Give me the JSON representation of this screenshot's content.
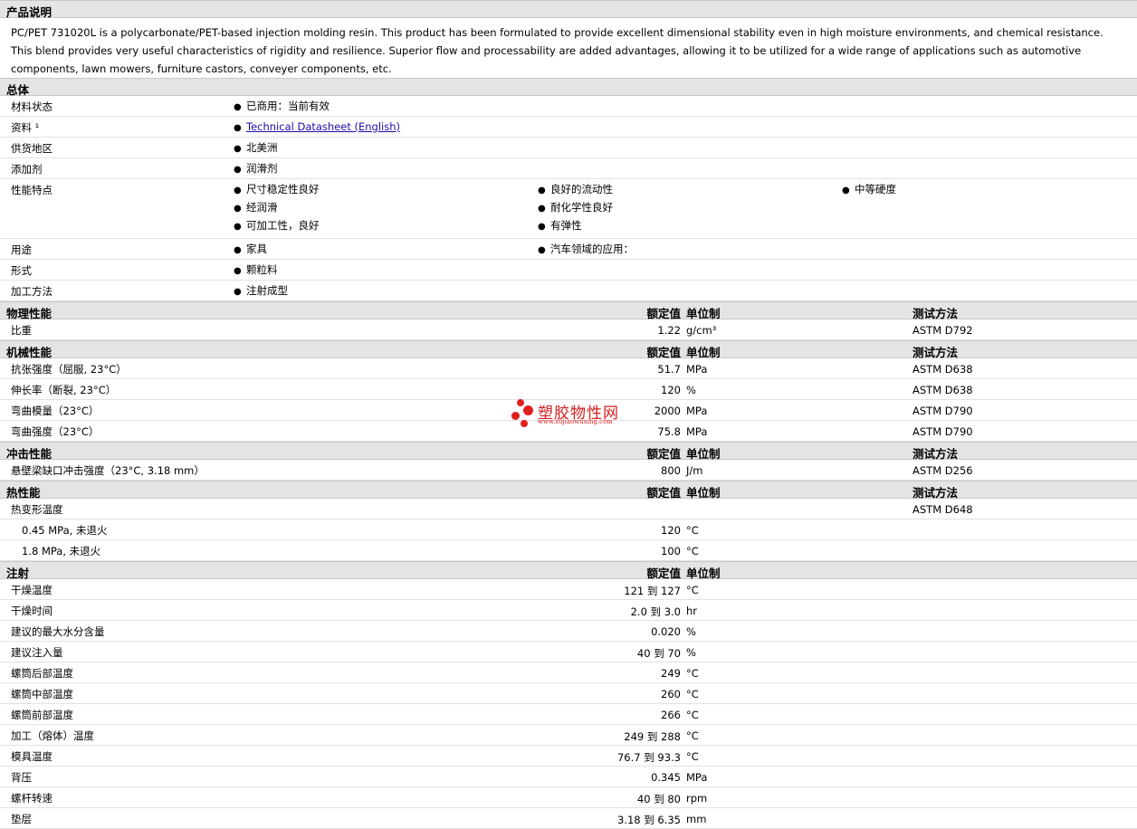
{
  "description": {
    "header": "产品说明",
    "text": "PC/PET 731020L is a polycarbonate/PET-based injection molding resin. This product has been formulated to provide excellent dimensional stability even in high moisture environments, and chemical resistance. This blend provides very useful characteristics of rigidity and resilience. Superior flow and processability are added advantages, allowing it to be utilized for a wide range of applications such as automotive components, lawn mowers, furniture castors, conveyer components, etc."
  },
  "general": {
    "header": "总体",
    "rows": [
      {
        "label": "材料状态",
        "cols": [
          [
            "已商用：当前有效"
          ]
        ]
      },
      {
        "label": "资料 ¹",
        "cols": [
          [
            "Technical Datasheet (English)"
          ]
        ]
      },
      {
        "label": "供货地区",
        "cols": [
          [
            "北美洲"
          ]
        ]
      },
      {
        "label": "添加剂",
        "cols": [
          [
            "润滑剂"
          ]
        ]
      },
      {
        "label": "性能特点",
        "cols": [
          [
            "尺寸稳定性良好",
            "经润滑",
            "可加工性，良好"
          ],
          [
            "良好的流动性",
            "耐化学性良好",
            "有弹性"
          ],
          [
            "中等硬度"
          ]
        ]
      },
      {
        "label": "用途",
        "cols": [
          [
            "家具"
          ],
          [
            "汽车领域的应用："
          ]
        ]
      },
      {
        "label": "形式",
        "cols": [
          [
            "颗粒料"
          ]
        ]
      },
      {
        "label": "加工方法",
        "cols": [
          [
            "注射成型"
          ]
        ]
      }
    ]
  },
  "column_headers": {
    "value": "额定值",
    "unit": "单位制",
    "method": "测试方法"
  },
  "sections": [
    {
      "title": "物理性能",
      "has_method": true,
      "rows": [
        {
          "label": "比重",
          "value": "1.22",
          "unit": "g/cm³",
          "method": "ASTM D792"
        }
      ]
    },
    {
      "title": "机械性能",
      "has_method": true,
      "rows": [
        {
          "label": "抗张强度（屈服, 23°C）",
          "value": "51.7",
          "unit": "MPa",
          "method": "ASTM D638"
        },
        {
          "label": "伸长率（断裂, 23°C）",
          "value": "120",
          "unit": "%",
          "method": "ASTM D638"
        },
        {
          "label": "弯曲模量（23°C）",
          "value": "2000",
          "unit": "MPa",
          "method": "ASTM D790"
        },
        {
          "label": "弯曲强度（23°C）",
          "value": "75.8",
          "unit": "MPa",
          "method": "ASTM D790"
        }
      ]
    },
    {
      "title": "冲击性能",
      "has_method": true,
      "rows": [
        {
          "label": "悬壁梁缺口冲击强度（23°C, 3.18 mm）",
          "value": "800",
          "unit": "J/m",
          "method": "ASTM D256"
        }
      ]
    },
    {
      "title": "热性能",
      "has_method": true,
      "rows": [
        {
          "label": "热变形温度",
          "value": "",
          "unit": "",
          "method": "ASTM D648"
        },
        {
          "label": "0.45 MPa, 未退火",
          "value": "120",
          "unit": "°C",
          "method": "",
          "indent": true
        },
        {
          "label": "1.8 MPa, 未退火",
          "value": "100",
          "unit": "°C",
          "method": "",
          "indent": true
        }
      ]
    },
    {
      "title": "注射",
      "has_method": false,
      "rows": [
        {
          "label": "干燥温度",
          "value": "121 到 127",
          "unit": "°C",
          "method": ""
        },
        {
          "label": "干燥时间",
          "value": "2.0 到 3.0",
          "unit": "hr",
          "method": ""
        },
        {
          "label": "建议的最大水分含量",
          "value": "0.020",
          "unit": "%",
          "method": ""
        },
        {
          "label": "建议注入量",
          "value": "40 到 70",
          "unit": "%",
          "method": ""
        },
        {
          "label": "螺筒后部温度",
          "value": "249",
          "unit": "°C",
          "method": ""
        },
        {
          "label": "螺筒中部温度",
          "value": "260",
          "unit": "°C",
          "method": ""
        },
        {
          "label": "螺筒前部温度",
          "value": "266",
          "unit": "°C",
          "method": ""
        },
        {
          "label": "加工（熔体）温度",
          "value": "249 到 288",
          "unit": "°C",
          "method": ""
        },
        {
          "label": "模具温度",
          "value": "76.7 到 93.3",
          "unit": "°C",
          "method": ""
        },
        {
          "label": "背压",
          "value": "0.345",
          "unit": "MPa",
          "method": ""
        },
        {
          "label": "螺杆转速",
          "value": "40 到 80",
          "unit": "rpm",
          "method": ""
        },
        {
          "label": "垫层",
          "value": "3.18 到 6.35",
          "unit": "mm",
          "method": ""
        }
      ]
    }
  ],
  "watermark": {
    "name": "塑胶物性网",
    "url": "www.sujiaowuxing.com"
  }
}
